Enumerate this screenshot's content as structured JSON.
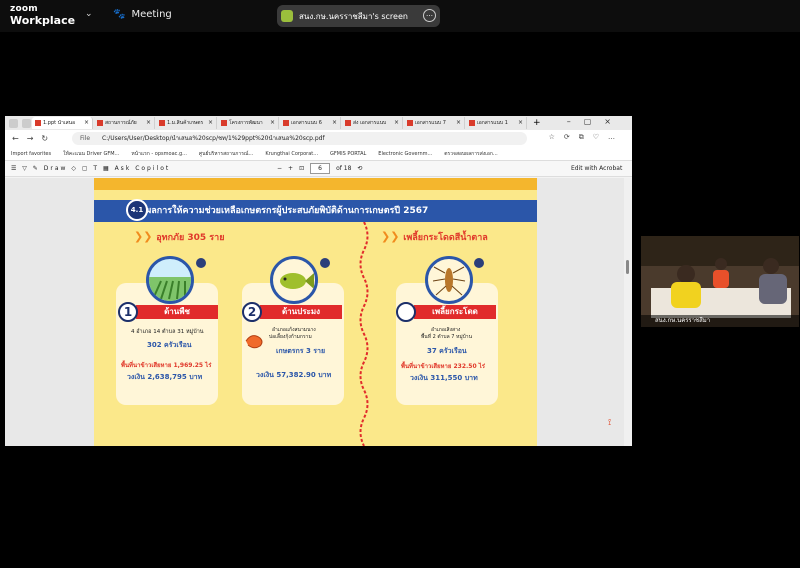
{
  "zoom": {
    "logo_line1": "zoom",
    "logo_line2": "Workplace",
    "meeting_label": "Meeting",
    "share_label": "สนง.กษ.นครราชสีมา's screen"
  },
  "browser": {
    "tabs": [
      {
        "label": "1.ppt นำเสนอ"
      },
      {
        "label": "สถานการณ์ภัย"
      },
      {
        "label": "1.ม.สินค้าเกษตร"
      },
      {
        "label": "โครงการพัฒนา"
      },
      {
        "label": "เอกสารแนบ 6"
      },
      {
        "label": "ส่ง เอกสารแนบ"
      },
      {
        "label": "เอกสารแนบ 7"
      },
      {
        "label": "เอกสารแนบ 1"
      }
    ],
    "address_file_label": "File",
    "address_url": "C:/Users/User/Desktop/นำเสนอ%20scp/ชท/1%29ppt%20นำเสนอ%20scp.pdf",
    "favorites": [
      "Import favorites",
      "ให้คะแนน Driver GFM...",
      "หน้าแรก - opsmoac.g...",
      "ศูนย์บริหารสถานการณ์...",
      "Krungthai Corporat...",
      "GFMIS PORTAL",
      "Electronic Governm...",
      "ตรวจสอบผลการส่งเอก..."
    ],
    "pdf_draw_label": "Draw",
    "pdf_copilot_label": "Ask Copilot",
    "pdf_page": "6",
    "pdf_of": "of 18",
    "pdf_edit_label": "Edit with Acrobat"
  },
  "slide": {
    "badge": "4.1",
    "title": "ผลการให้ความช่วยเหลือเกษตรกรผู้ประสบภัยพิบัติด้านการเกษตรปี 2567",
    "flood_title": "อุทกภัย 305 ราย",
    "pest_title": "เพลี้ยกระโดดสีน้ำตาล",
    "cards": [
      {
        "num": "1",
        "title": "ด้านพืช",
        "line1": "4 อำเภอ 14 ตำบล 31 หมู่บ้าน",
        "households": "302 ครัวเรือน",
        "area": "พื้นที่นาข้าวเสียหาย 1,969.25 ไร่",
        "budget": "วงเงิน 2,638,795 บาท"
      },
      {
        "num": "2",
        "title": "ด้านประมง",
        "line1": "อำเภอแก้งสนามนาง",
        "line2": "บ่อเลี้ยงกุ้งก้ามกราม",
        "households": "เกษตรกร 3 ราย",
        "budget": "วงเงิน 57,382.90 บาท"
      },
      {
        "num": "",
        "title": "เพลี้ยกระโดด",
        "line1": "อำเภอเสิงสาง",
        "line2": "พื้นที่ 2 ตำบล 7 หมู่บ้าน",
        "households": "37 ครัวเรือน",
        "area": "พื้นที่นาข้าวเสียหาย 232.50 ไร่",
        "budget": "วงเงิน 311,550 บาท"
      }
    ]
  },
  "video": {
    "label": "สนง.กษ.นครราชสีมา"
  },
  "colors": {
    "banner": "#2b56a9",
    "slide_bg": "#fbe88a",
    "red": "#e12b2b",
    "accent": "#f08b1d"
  }
}
